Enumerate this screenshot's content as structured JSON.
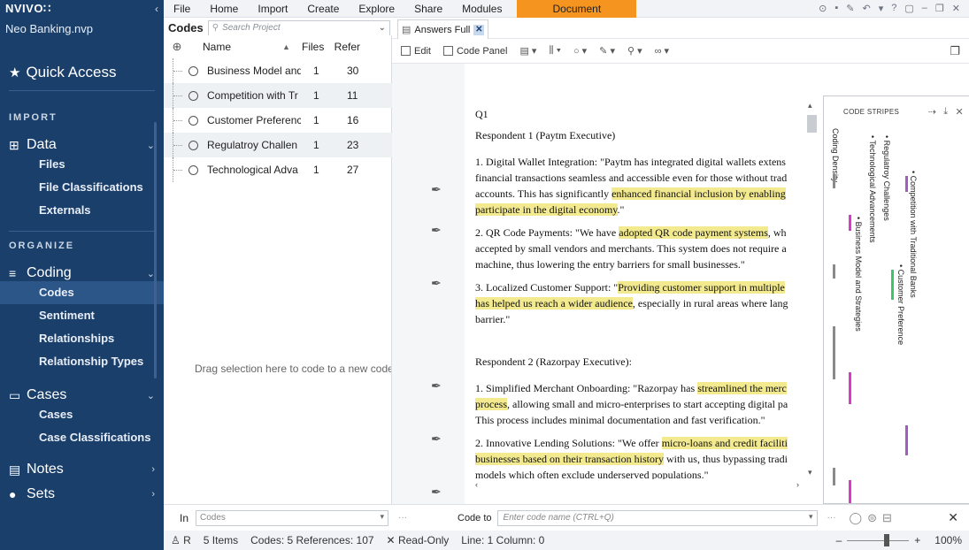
{
  "app": {
    "logo": "NVIVO∷",
    "project": "Neo Banking.nvp"
  },
  "menu": [
    "File",
    "Home",
    "Import",
    "Create",
    "Explore",
    "Share",
    "Modules"
  ],
  "menu_active": "Document",
  "sidebar": {
    "quick_access": "Quick Access",
    "import_head": "IMPORT",
    "data": {
      "label": "Data",
      "items": [
        "Files",
        "File Classifications",
        "Externals"
      ]
    },
    "organize_head": "ORGANIZE",
    "coding": {
      "label": "Coding",
      "items": [
        "Codes",
        "Sentiment",
        "Relationships",
        "Relationship Types"
      ]
    },
    "cases": {
      "label": "Cases",
      "items": [
        "Cases",
        "Case Classifications"
      ]
    },
    "notes": "Notes",
    "sets": "Sets"
  },
  "codes_panel": {
    "title": "Codes",
    "search_placeholder": "Search Project",
    "col_name": "Name",
    "col_files": "Files",
    "col_refs": "Refer",
    "rows": [
      {
        "name": "Business Model and",
        "files": "1",
        "refs": "30"
      },
      {
        "name": "Competition with Tr",
        "files": "1",
        "refs": "11"
      },
      {
        "name": "Customer Preferenc",
        "files": "1",
        "refs": "16"
      },
      {
        "name": "Regulatroy Challen",
        "files": "1",
        "refs": "23"
      },
      {
        "name": "Technological Adva",
        "files": "1",
        "refs": "27"
      }
    ],
    "drag_hint": "Drag selection here to code to a new code"
  },
  "document": {
    "tab": "Answers Full",
    "toolbar": {
      "edit": "Edit",
      "code_panel": "Code Panel"
    },
    "heading": "Q1",
    "r1_title": "Respondent 1 (Paytm Executive)",
    "p1_a": "1. Digital Wallet Integration: \"Paytm has integrated digital wallets extens",
    "p1_b": "financial transactions seamless and accessible even for those without trad",
    "p1_c1": "accounts. This has significantly ",
    "p1_c_hl": "enhanced financial inclusion by enabling",
    "p1_d_hl": "participate in the digital economy",
    "p1_d2": ".\"",
    "p2_a1": "2. QR Code Payments: \"We have ",
    "p2_a_hl": "adopted QR code payment systems",
    "p2_a2": ", wh",
    "p2_b": "accepted by small vendors and merchants. This system does not require a",
    "p2_c": "machine, thus lowering the entry barriers for small businesses.\"",
    "p3_a1": "3. Localized Customer Support: \"",
    "p3_a_hl": "Providing customer support in multiple",
    "p3_b_hl": "has helped us reach a wider audience",
    "p3_b2": ", especially in rural areas where lang",
    "p3_c": "barrier.\"",
    "r2_title": "Respondent 2 (Razorpay Executive):",
    "p4_a1": "1. Simplified Merchant Onboarding: \"Razorpay has ",
    "p4_a_hl": "streamlined the merc",
    "p4_b_hl": "process",
    "p4_b2": ", allowing small and micro-enterprises to start accepting digital pa",
    "p4_c": "This process includes minimal documentation and fast verification.\"",
    "p5_a1": "2. Innovative Lending Solutions: \"We offer ",
    "p5_a_hl": "micro-loans and credit faciliti",
    "p5_b_hl": "businesses based on their transaction history",
    "p5_b2": " with us, thus bypassing tradi",
    "p5_c": "models which often exclude underserved populations.\""
  },
  "stripes": {
    "title": "CODE STRIPES",
    "labels": [
      "Coding Density",
      "• Business Model and Strategies",
      "• Technological Advancements",
      "• Regulatroy Challenges",
      "• Customer Preference",
      "• Competition with Traditional Banks"
    ],
    "colors": {
      "magenta": "#d63cc9",
      "green": "#3fc46b",
      "purple": "#a05cc0",
      "gray": "#8a8a8a"
    }
  },
  "bottom": {
    "in_label": "In",
    "in_value": "Codes",
    "codeto_label": "Code to",
    "codeto_placeholder": "Enter code name (CTRL+Q)"
  },
  "status": {
    "user": "R",
    "items": "5 Items",
    "codes": "Codes: 5  References: 107",
    "readonly": "Read-Only",
    "line": "Line: 1  Column: 0",
    "zoom": "100%"
  }
}
